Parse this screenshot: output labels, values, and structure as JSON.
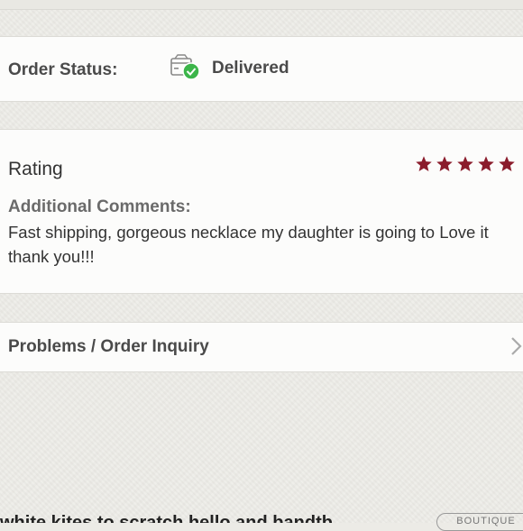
{
  "order": {
    "status_label": "Order Status:",
    "status_value": "Delivered",
    "status_icon": "delivered-box-icon",
    "check_color": "#3cb54a"
  },
  "rating": {
    "title": "Rating",
    "stars": 5,
    "max_stars": 5,
    "star_color": "#8b1c2c",
    "comments_label": "Additional Comments:",
    "comments_text": "Fast shipping, gorgeous necklace my daughter is going to Love it thank you!!!"
  },
  "inquiry": {
    "label": "Problems / Order Inquiry",
    "chevron_icon": "chevron-right-icon"
  },
  "footer": {
    "partial_text": "white kites to scratch hello and bandtb",
    "badge_text": "BOUTIQUE"
  }
}
